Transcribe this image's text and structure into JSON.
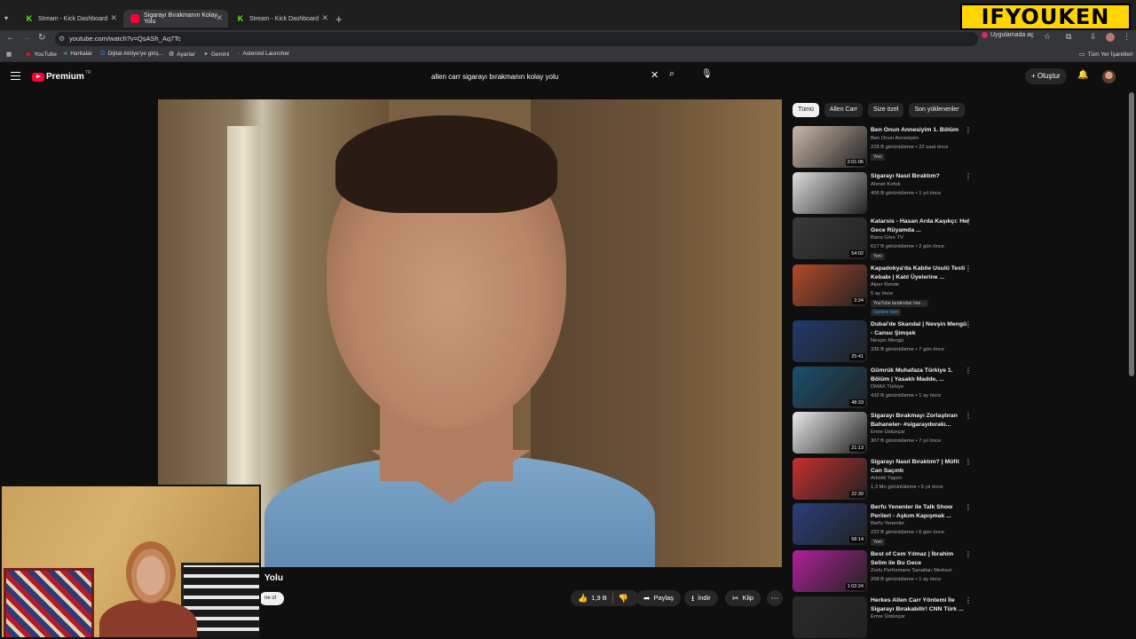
{
  "browser": {
    "tabs": [
      {
        "label": "Stream - Kick Dashboard",
        "favicon": "kick-icon"
      },
      {
        "label": "Sigarayı Bırakmanın Kolay Yolu",
        "favicon": "youtube-icon"
      },
      {
        "label": "Stream - Kick Dashboard",
        "favicon": "kick-icon"
      }
    ],
    "url": "youtube.com/watch?v=QsASh_Aq7Tc",
    "app_button": "Uygulamada aç",
    "bookmarks": [
      {
        "label": "YouTube"
      },
      {
        "label": "Haritalar"
      },
      {
        "label": "Dijital Atölye'ye giriş..."
      },
      {
        "label": "Ayarlar"
      },
      {
        "label": "Gemini"
      },
      {
        "label": "Asteroid Launcher"
      }
    ],
    "bookmarks_right": "Tüm Yer İşaretleri"
  },
  "watermark": "IFYOUKEN",
  "youtube": {
    "logo_text": "Premium",
    "logo_suffix": "TR",
    "search_value": "allen carr sigarayı bırakmanın kolay yolu",
    "create_label": "Oluştur"
  },
  "video": {
    "title_fragment": "Yolu",
    "pill_fragment": "ne ol",
    "like_count": "1,9 B",
    "share_label": "Paylaş",
    "download_label": "İndir",
    "clip_label": "Klip"
  },
  "chips": [
    "Tümü",
    "Allen Carr",
    "Size özel",
    "Son yüklenenler"
  ],
  "recommendations": [
    {
      "title": "Ben Onun Annesiyim 1. Bölüm",
      "channel": "Ben Onun Annesiyim",
      "meta": "228 B görüntüleme • 22 saat önce",
      "badge": "Yeni",
      "duration": "2:01:06",
      "thumb_color": "#c9b7a8"
    },
    {
      "title": "Sigarayı Nasıl Bıraktım?",
      "channel": "Ahmet Kırtok",
      "meta": "406 B görüntüleme • 1 yıl önce",
      "badge": "",
      "duration": "",
      "thumb_color": "#dcdcdc"
    },
    {
      "title": "Katarsis - Hasan Arda Kaşıkçı: Her Gece Rüyamda ...",
      "channel": "Bana Göre TV",
      "meta": "617 B görüntüleme • 2 gün önce",
      "badge": "Yeni",
      "duration": "54:02",
      "thumb_color": "#3a3a3a"
    },
    {
      "title": "Kapadokya'da Kabile Usulü Testi Kebabı | Katıl Üyelerine ...",
      "channel": "Alper Rende",
      "meta": "5 ay önce",
      "badge": "YouTube tarafından öne ...",
      "badge2": "Üyelere özel",
      "duration": "3:24",
      "thumb_color": "#b24a2a"
    },
    {
      "title": "Dubai'de Skandal | Nevşin Mengü - Cansu Şimşek",
      "channel": "Nevşin Mengü",
      "meta": "336 B görüntüleme • 7 gün önce",
      "badge": "",
      "duration": "25:41",
      "thumb_color": "#203a6a"
    },
    {
      "title": "Gümrük Muhafaza Türkiye 1. Bölüm | Yasaklı Madde, ...",
      "channel": "DMAX Türkiye",
      "meta": "432 B görüntüleme • 1 ay önce",
      "badge": "",
      "duration": "48:33",
      "thumb_color": "#1d4f6e"
    },
    {
      "title": "Sigarayı Bırakmayı Zorlaştıran Bahaneler- #sigarayıbırakı...",
      "channel": "Emre Üstünçar",
      "meta": "307 B görüntüleme • 7 yıl önce",
      "badge": "",
      "duration": "21:13",
      "thumb_color": "#e9e9e9"
    },
    {
      "title": "Sigarayı Nasıl Bıraktım? | Müfit Can Saçıntı",
      "channel": "Artistik Yapım",
      "meta": "1,3 Mn görüntüleme • 5 yıl önce",
      "badge": "",
      "duration": "22:30",
      "thumb_color": "#c43030"
    },
    {
      "title": "Berfu Yenenler ile Talk Show Perileri - Aşkım Kapışmak ...",
      "channel": "Berfu Yenenler",
      "meta": "222 B görüntüleme • 6 gün önce",
      "badge": "Yeni",
      "duration": "58:14",
      "thumb_color": "#2a3e7a"
    },
    {
      "title": "Best of Cem Yılmaz | İbrahim Selim ile Bu Gece",
      "channel": "Zorlu Performans Sanatları Merkezi",
      "meta": "268 B görüntüleme • 1 ay önce",
      "badge": "",
      "duration": "1:02:24",
      "thumb_color": "#b0209a"
    },
    {
      "title": "Herkes Allen Carr Yöntemi İle Sigarayı Bırakabilir! CNN Türk ...",
      "channel": "Emre Üstünçar",
      "meta": "",
      "badge": "",
      "duration": "",
      "thumb_color": "#2a2a2a"
    }
  ]
}
